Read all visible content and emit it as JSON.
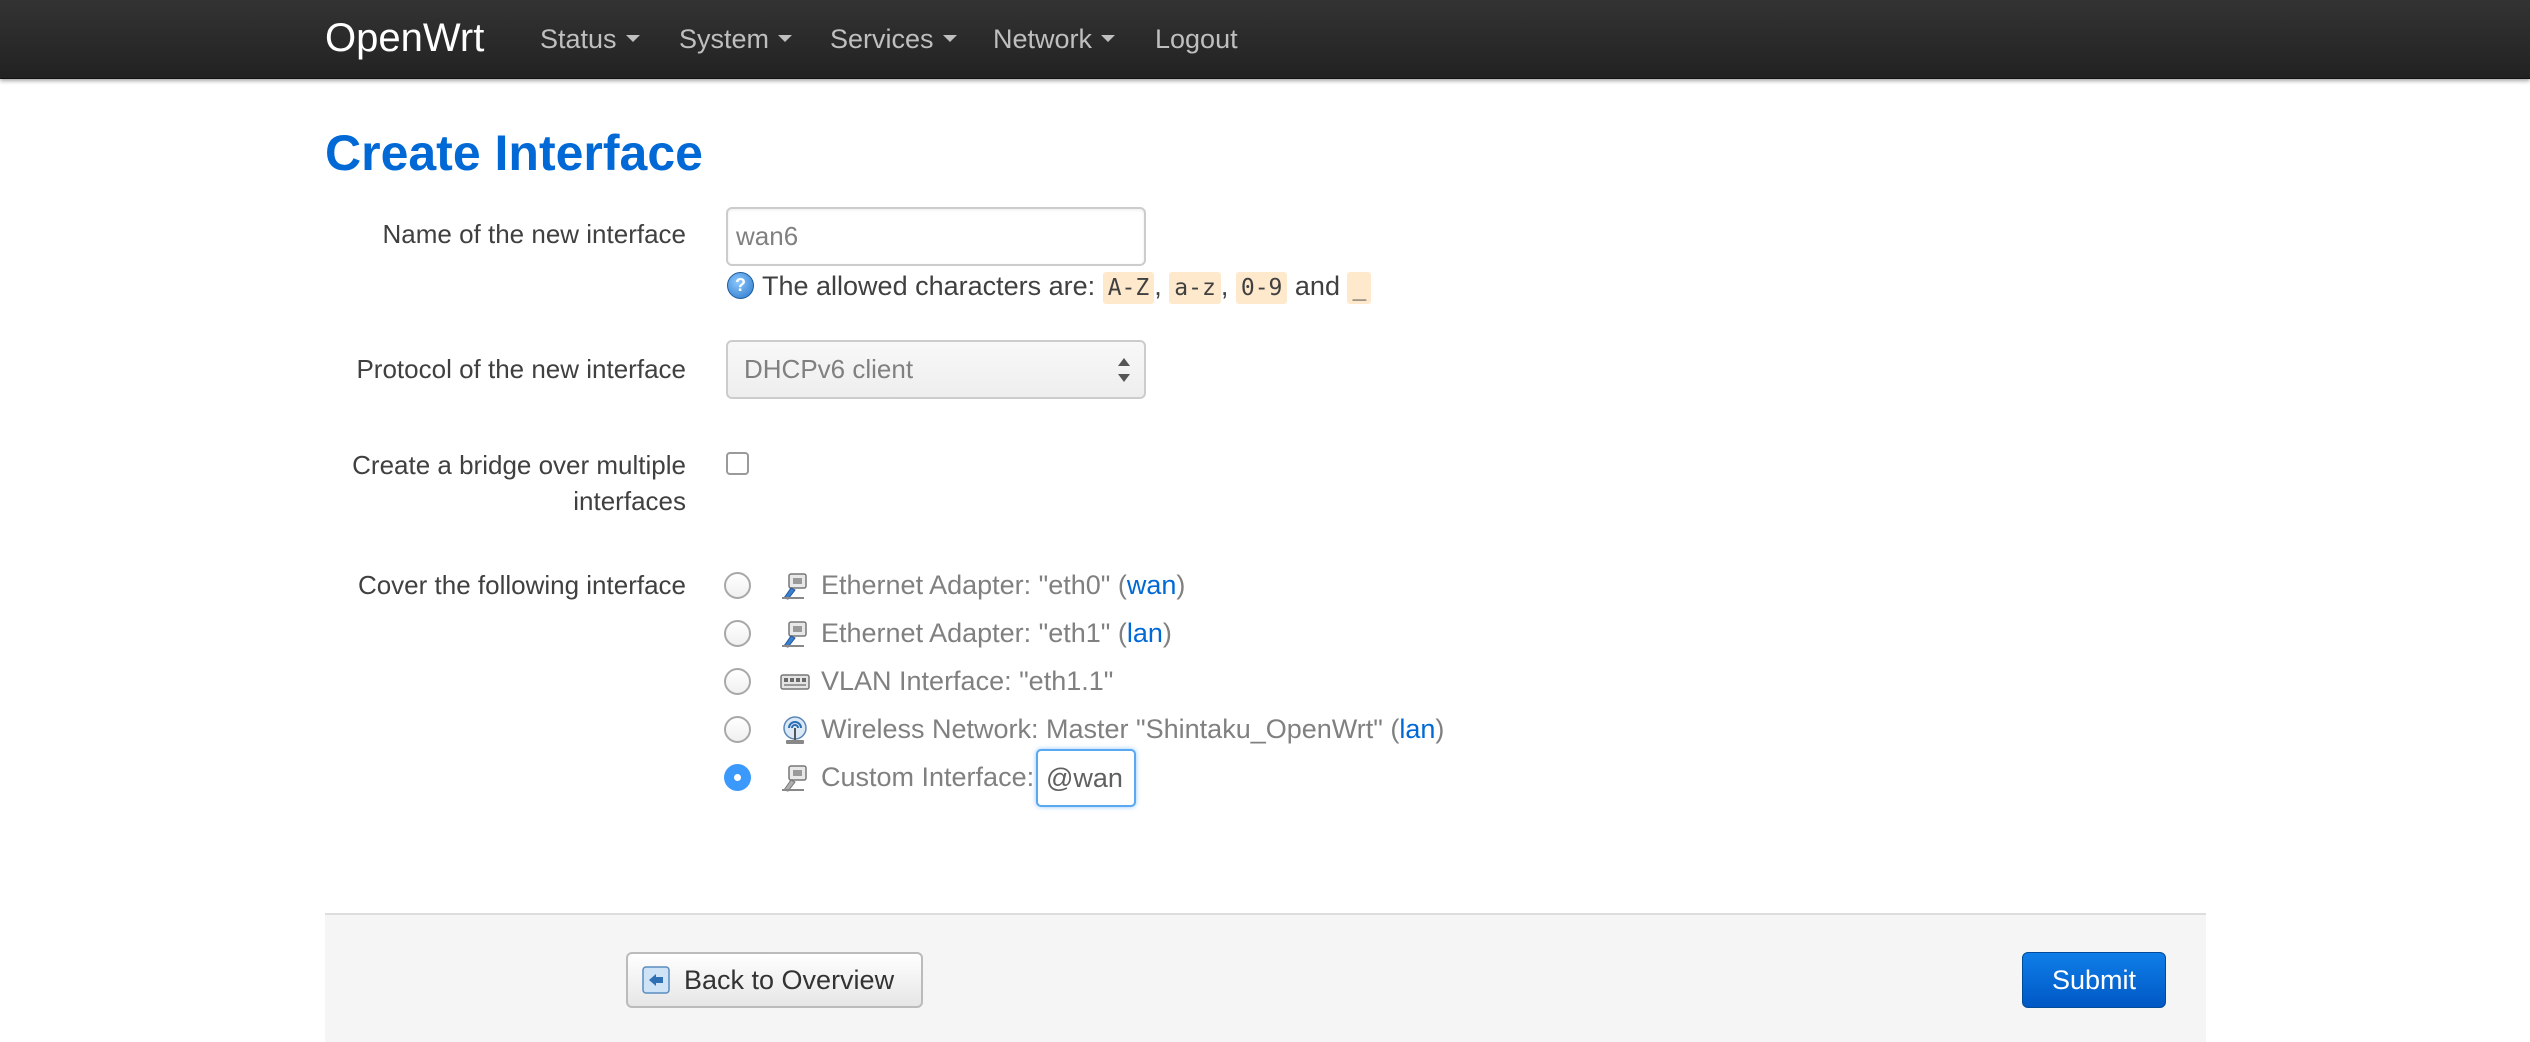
{
  "navbar": {
    "brand": "OpenWrt",
    "items": [
      {
        "label": "Status",
        "dropdown": true
      },
      {
        "label": "System",
        "dropdown": true
      },
      {
        "label": "Services",
        "dropdown": true
      },
      {
        "label": "Network",
        "dropdown": true
      },
      {
        "label": "Logout",
        "dropdown": false
      }
    ]
  },
  "page": {
    "title": "Create Interface"
  },
  "form": {
    "name": {
      "label": "Name of the new interface",
      "value": "wan6",
      "hint_prefix": "The allowed characters are:",
      "hint_tokens": [
        "A-Z",
        "a-z",
        "0-9",
        "_"
      ],
      "hint_comma": ",",
      "hint_and": "and",
      "help_icon_glyph": "?"
    },
    "protocol": {
      "label": "Protocol of the new interface",
      "selected": "DHCPv6 client"
    },
    "bridge": {
      "label_line1": "Create a bridge over multiple",
      "label_line2": "interfaces",
      "checked": false
    },
    "cover": {
      "label": "Cover the following interface",
      "options": [
        {
          "icon": "ethernet-port-icon",
          "text": "Ethernet Adapter: \"eth0\" (",
          "link": "wan",
          "suffix": ")",
          "checked": false
        },
        {
          "icon": "ethernet-port-icon",
          "text": "Ethernet Adapter: \"eth1\" (",
          "link": "lan",
          "suffix": ")",
          "checked": false
        },
        {
          "icon": "vlan-switch-icon",
          "text": "VLAN Interface: \"eth1.1\"",
          "link": "",
          "suffix": "",
          "checked": false
        },
        {
          "icon": "wireless-icon",
          "text": "Wireless Network: Master \"Shintaku_OpenWrt\" (",
          "link": "lan",
          "suffix": ")",
          "checked": false
        },
        {
          "icon": "ethernet-port-icon",
          "text": "Custom Interface:",
          "link": "",
          "suffix": "",
          "checked": true
        }
      ],
      "custom_value": "@wan"
    }
  },
  "actions": {
    "back_label": "Back to Overview",
    "submit_label": "Submit"
  },
  "colors": {
    "accent": "#0069d6",
    "navbar": "#222222",
    "submit": "#0064d2",
    "token_bg": "#fee9cc"
  }
}
